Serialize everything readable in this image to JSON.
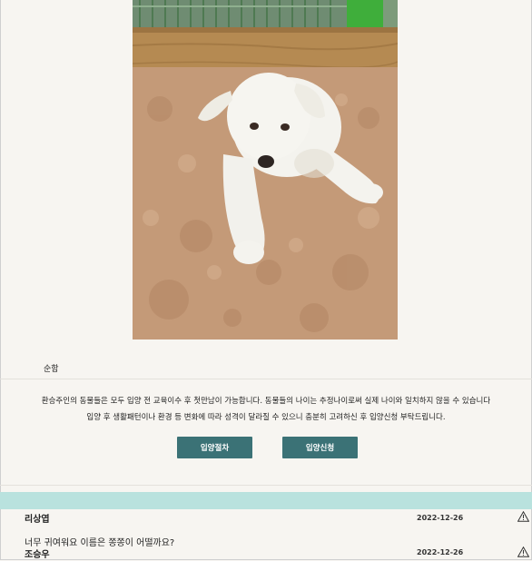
{
  "profile": {
    "temperament_label": "순함"
  },
  "notice": {
    "line1": "환승주인의 동물들은 모두 입양 전 교육이수 후 첫만남이 가능합니다. 동물들의 나이는 추정나이로써 실제 나이와 일치하지 않을 수 있습니다",
    "line2": "입양 후 생활패턴이나 환경 등 변화에 따라 성격이 달라질 수 있으니 충분히 고려하신 후 입양신청 부탁드립니다."
  },
  "buttons": {
    "process_label": "입양절차",
    "apply_label": "입양신청"
  },
  "colors": {
    "accent": "#3b7276",
    "comment_bar": "#b9e2de",
    "background": "#f7f5f1"
  },
  "comments": [
    {
      "author": "리상엽",
      "date": "2022-12-26",
      "text": "너무 귀여워요 이름은 쫑쫑이 어떨까요?",
      "icon": "warning-icon"
    },
    {
      "author": "조승우",
      "date": "2022-12-26",
      "text": "",
      "icon": "warning-icon"
    }
  ]
}
